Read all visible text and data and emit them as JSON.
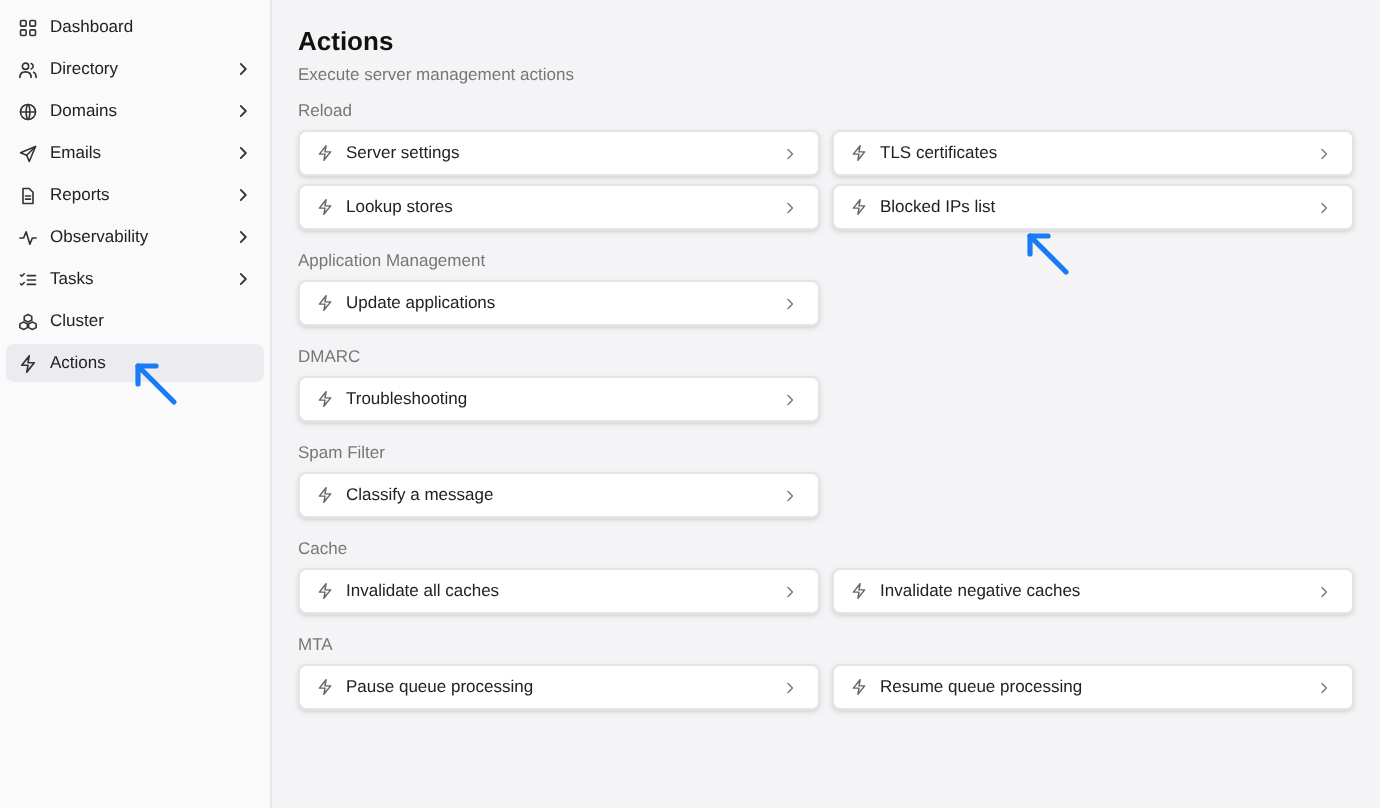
{
  "sidebar": {
    "items": [
      {
        "label": "Dashboard",
        "expandable": false,
        "selected": false
      },
      {
        "label": "Directory",
        "expandable": true,
        "selected": false
      },
      {
        "label": "Domains",
        "expandable": true,
        "selected": false
      },
      {
        "label": "Emails",
        "expandable": true,
        "selected": false
      },
      {
        "label": "Reports",
        "expandable": true,
        "selected": false
      },
      {
        "label": "Observability",
        "expandable": true,
        "selected": false
      },
      {
        "label": "Tasks",
        "expandable": true,
        "selected": false
      },
      {
        "label": "Cluster",
        "expandable": false,
        "selected": false
      },
      {
        "label": "Actions",
        "expandable": false,
        "selected": true
      }
    ]
  },
  "page": {
    "title": "Actions",
    "subtitle": "Execute server management actions"
  },
  "sections": [
    {
      "label": "Reload",
      "actions": [
        "Server settings",
        "TLS certificates",
        "Lookup stores",
        "Blocked IPs list"
      ]
    },
    {
      "label": "Application Management",
      "actions": [
        "Update applications"
      ]
    },
    {
      "label": "DMARC",
      "actions": [
        "Troubleshooting"
      ]
    },
    {
      "label": "Spam Filter",
      "actions": [
        "Classify a message"
      ]
    },
    {
      "label": "Cache",
      "actions": [
        "Invalidate all caches",
        "Invalidate negative caches"
      ]
    },
    {
      "label": "MTA",
      "actions": [
        "Pause queue processing",
        "Resume queue processing"
      ]
    }
  ]
}
